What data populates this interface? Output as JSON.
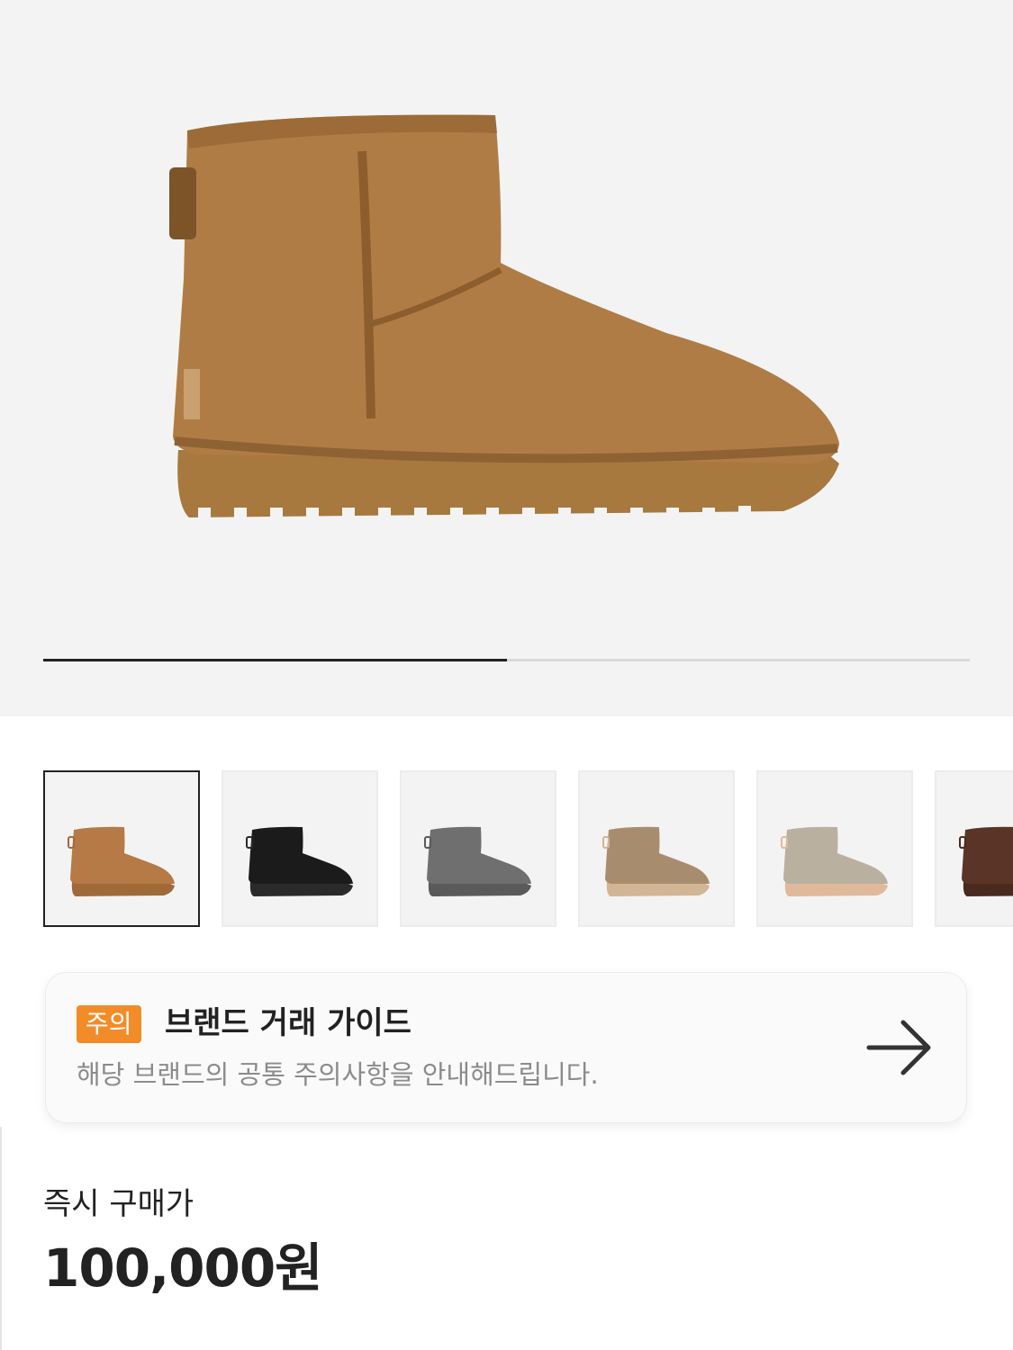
{
  "product": {
    "image_icon": "ankle-boot-image",
    "main_color": "#b07c45",
    "gallery_progress": 0.5
  },
  "thumbnails": [
    {
      "color_name": "chestnut",
      "color": "#b57a45",
      "sole": "#a06a38",
      "selected": true
    },
    {
      "color_name": "black",
      "color": "#1b1b1b",
      "sole": "#2a2a2a",
      "selected": false
    },
    {
      "color_name": "grey",
      "color": "#6f6f6f",
      "sole": "#5a5a5a",
      "selected": false
    },
    {
      "color_name": "sand",
      "color": "#a88c6e",
      "sole": "#d2b594",
      "selected": false
    },
    {
      "color_name": "goat",
      "color": "#b9b09f",
      "sole": "#e0b99a",
      "selected": false
    },
    {
      "color_name": "brown",
      "color": "#5a3426",
      "sole": "#4a2a1e",
      "selected": false
    }
  ],
  "guide": {
    "badge": "주의",
    "badge_color": "#f28c28",
    "title": "브랜드 거래 가이드",
    "subtitle": "해당 브랜드의 공통 주의사항을 안내해드립니다.",
    "arrow_icon": "arrow-right-icon"
  },
  "price": {
    "label": "즉시 구매가",
    "value": "100,000원"
  }
}
